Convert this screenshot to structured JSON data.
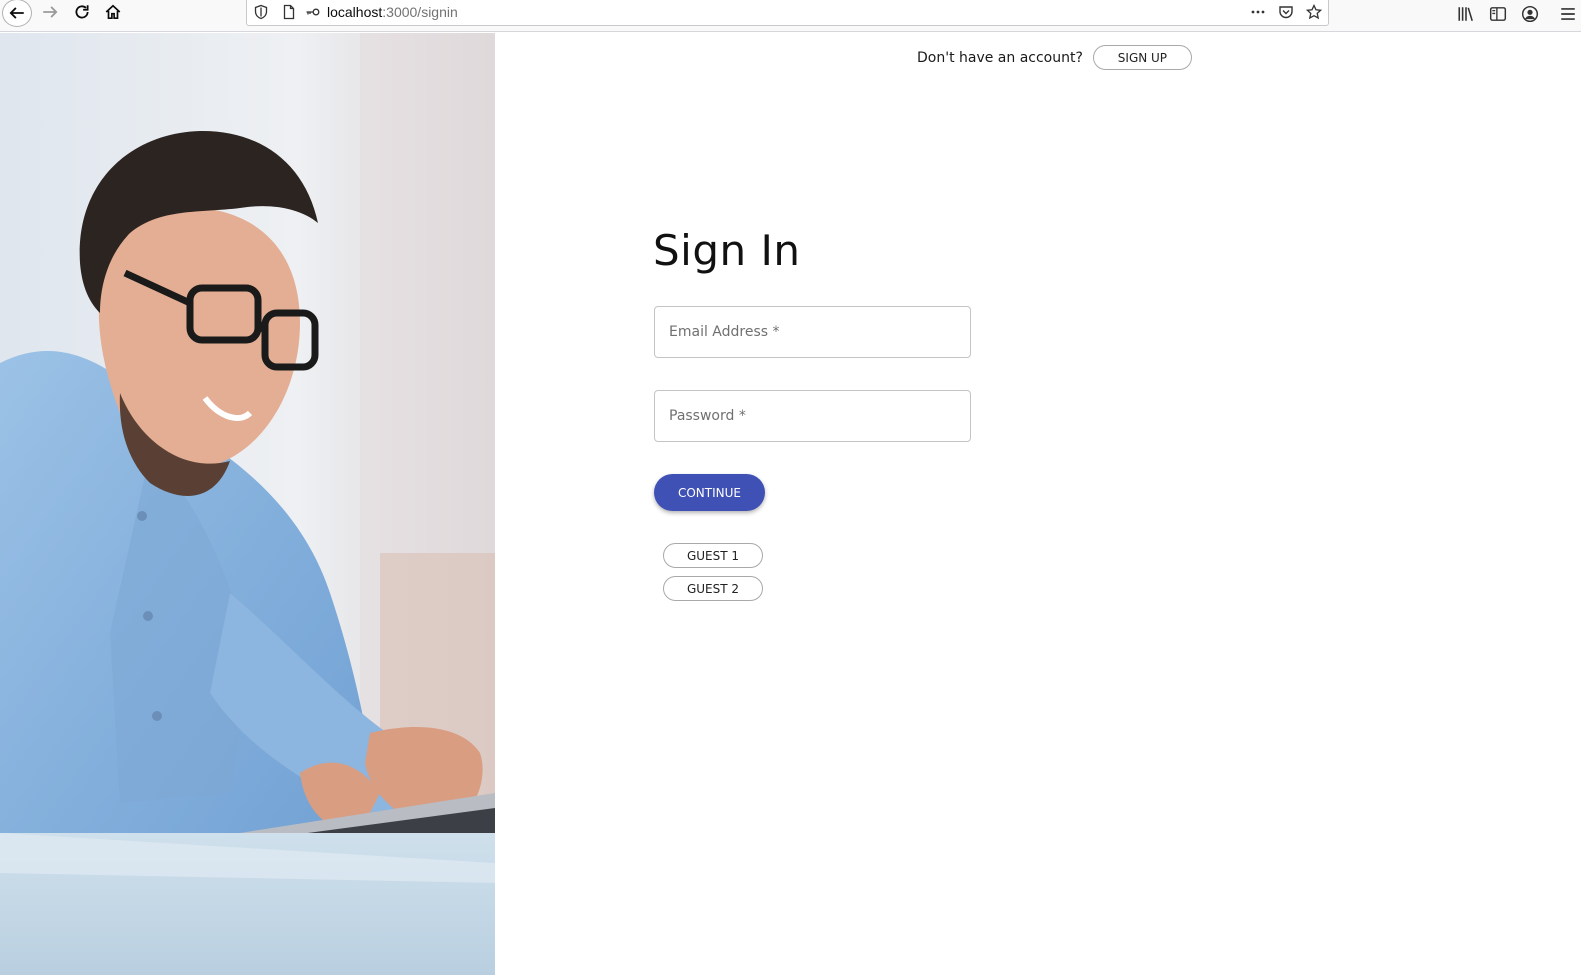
{
  "browser": {
    "url_host": "localhost",
    "url_path": ":3000/signin"
  },
  "header": {
    "prompt": "Don't have an account?",
    "signup_label": "SIGN UP"
  },
  "form": {
    "title": "Sign In",
    "email_placeholder": "Email Address *",
    "password_placeholder": "Password *",
    "continue_label": "CONTINUE",
    "guest1_label": "GUEST 1",
    "guest2_label": "GUEST 2"
  },
  "colors": {
    "primary": "#3f51b5"
  },
  "icons": [
    "back-arrow-icon",
    "forward-arrow-icon",
    "reload-icon",
    "home-icon",
    "shield-icon",
    "page-icon",
    "key-icon",
    "more-icon",
    "pocket-icon",
    "star-icon",
    "library-icon",
    "sidebar-icon",
    "account-icon",
    "menu-icon"
  ]
}
